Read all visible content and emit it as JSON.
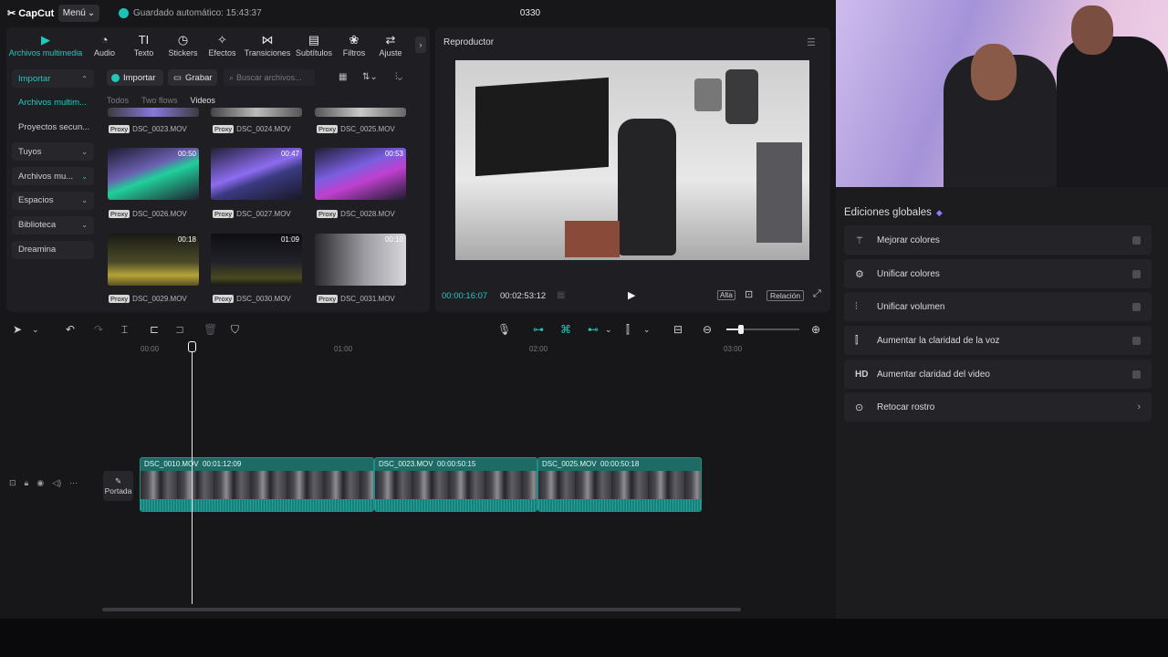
{
  "app": {
    "logo": "CapCut",
    "menu_label": "Menú",
    "autosave": "Guardado automático: 15:43:37",
    "project_title": "0330"
  },
  "toolbar": [
    {
      "label": "Archivos multimedia",
      "icon": "media-icon"
    },
    {
      "label": "Audio",
      "icon": "audio-icon"
    },
    {
      "label": "Texto",
      "icon": "text-icon"
    },
    {
      "label": "Stickers",
      "icon": "sticker-icon"
    },
    {
      "label": "Efectos",
      "icon": "effects-icon"
    },
    {
      "label": "Transiciones",
      "icon": "transitions-icon"
    },
    {
      "label": "Subtítulos",
      "icon": "subtitles-icon"
    },
    {
      "label": "Filtros",
      "icon": "filters-icon"
    },
    {
      "label": "Ajuste",
      "icon": "adjust-icon"
    }
  ],
  "sidebar": [
    {
      "label": "Importar"
    },
    {
      "label": "Archivos multim..."
    },
    {
      "label": "Proyectos secun..."
    },
    {
      "label": "Tuyos"
    },
    {
      "label": "Archivos mu..."
    },
    {
      "label": "Espacios"
    },
    {
      "label": "Biblioteca"
    },
    {
      "label": "Dreamina"
    }
  ],
  "media": {
    "import_button": "Importar",
    "record_button": "Grabar",
    "search_placeholder": "Buscar archivos...",
    "filters": [
      "Todos",
      "Two flows",
      "Videos"
    ],
    "proxy_tag": "Proxy",
    "files": [
      {
        "name": "DSC_0023.MOV",
        "duration": ""
      },
      {
        "name": "DSC_0024.MOV",
        "duration": ""
      },
      {
        "name": "DSC_0025.MOV",
        "duration": ""
      },
      {
        "name": "DSC_0026.MOV",
        "duration": "00:50"
      },
      {
        "name": "DSC_0027.MOV",
        "duration": "00:47"
      },
      {
        "name": "DSC_0028.MOV",
        "duration": "00:53"
      },
      {
        "name": "DSC_0029.MOV",
        "duration": "00:18"
      },
      {
        "name": "DSC_0030.MOV",
        "duration": "01:09"
      },
      {
        "name": "DSC_0031.MOV",
        "duration": "00:10"
      }
    ]
  },
  "player": {
    "title": "Reproductor",
    "current_time": "00:00:16:07",
    "total_time": "00:02:53:12",
    "quality_label": "Alta",
    "ratio_label": "Relación"
  },
  "timeline": {
    "ruler": [
      "00:00",
      "01:00",
      "02:00",
      "03:00"
    ],
    "cover_label": "Portada",
    "clips": [
      {
        "name": "DSC_0010.MOV",
        "duration": "00:01:12:09"
      },
      {
        "name": "DSC_0023.MOV",
        "duration": "00:00:50:15"
      },
      {
        "name": "DSC_0025.MOV",
        "duration": "00:00:50:18"
      }
    ]
  },
  "global_edits": {
    "title": "Ediciones globales",
    "items": [
      {
        "label": "Mejorar colores",
        "icon": "magic-wand-icon"
      },
      {
        "label": "Unificar colores",
        "icon": "color-match-icon"
      },
      {
        "label": "Unificar volumen",
        "icon": "volume-sliders-icon"
      },
      {
        "label": "Aumentar la claridad de la voz",
        "icon": "voice-clarity-icon"
      },
      {
        "label": "Aumentar claridad del video",
        "icon": "hd-icon"
      },
      {
        "label": "Retocar rostro",
        "icon": "face-retouch-icon"
      }
    ]
  },
  "colors": {
    "accent": "#1ec9c0",
    "background": "#17171a",
    "panel": "#1f1f23",
    "clip": "#1e6b66"
  }
}
